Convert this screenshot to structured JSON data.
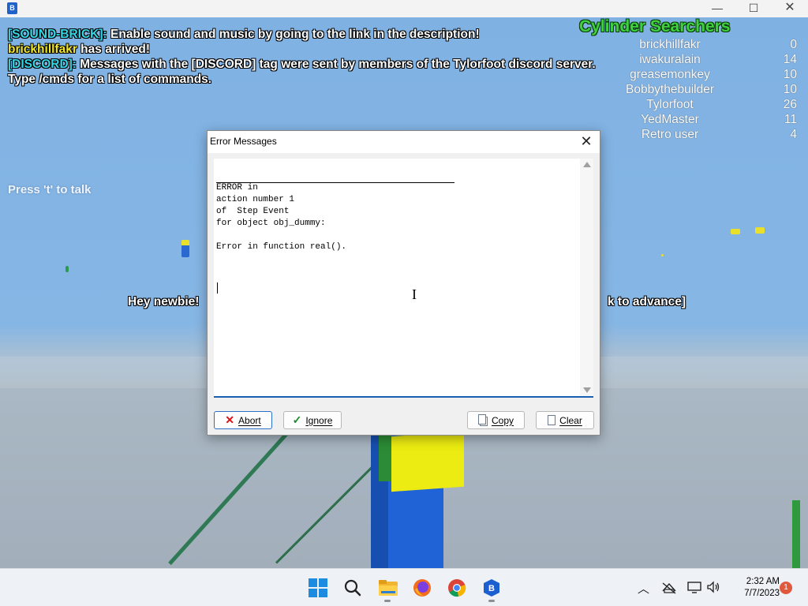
{
  "window": {
    "app_icon": "B",
    "minimize_symbol": "—",
    "maximize_symbol": "☐",
    "close_symbol": "✕"
  },
  "chat": {
    "lines": [
      {
        "tag": "[SOUND-BRICK]:",
        "text": " Enable sound and music by going to the link in the description!"
      },
      {
        "tag": "brickhillfakr",
        "text": " has arrived!"
      },
      {
        "tag": "[DISCORD]:",
        "text": " Messages with the [DISCORD] tag were sent by members of the Tylorfoot discord server."
      },
      {
        "tag": "",
        "text": "Type /cmds for a list of commands."
      }
    ],
    "hint": "Press 't' to talk",
    "bubble_left": "Hey newbie! ",
    "bubble_right": "k to advance]"
  },
  "leaderboard": {
    "title": "Cylinder Searchers",
    "rows": [
      {
        "name": "brickhillfakr",
        "score": "0"
      },
      {
        "name": "iwakuralain",
        "score": "14"
      },
      {
        "name": "greasemonkey",
        "score": "10"
      },
      {
        "name": "Bobbythebuilder",
        "score": "10"
      },
      {
        "name": "Tylorfoot",
        "score": "26"
      },
      {
        "name": "YedMaster",
        "score": "11"
      },
      {
        "name": "Retro user",
        "score": "4"
      }
    ]
  },
  "dialog": {
    "title": "Error Messages",
    "close_symbol": "✕",
    "error_text": "\n\nERROR in\naction number 1\nof  Step Event\nfor object obj_dummy:\n\nError in function real().",
    "buttons": {
      "abort": "Abort",
      "ignore": "Ignore",
      "copy": "Copy",
      "clear": "Clear"
    }
  },
  "taskbar": {
    "clock_time": "2:32 AM",
    "clock_date": "7/7/2023",
    "notification_count": "1",
    "tray_chevron": "︿"
  },
  "colors": {
    "sky": "#7fb1e3",
    "chat_tag_cyan": "#35d6e6",
    "chat_tag_yellow": "#f3e72a",
    "leaderboard_title": "#3fd13f",
    "avatar_body": "#1f63d6",
    "avatar_head": "#ecec12",
    "accent": "#1a5fb4"
  }
}
